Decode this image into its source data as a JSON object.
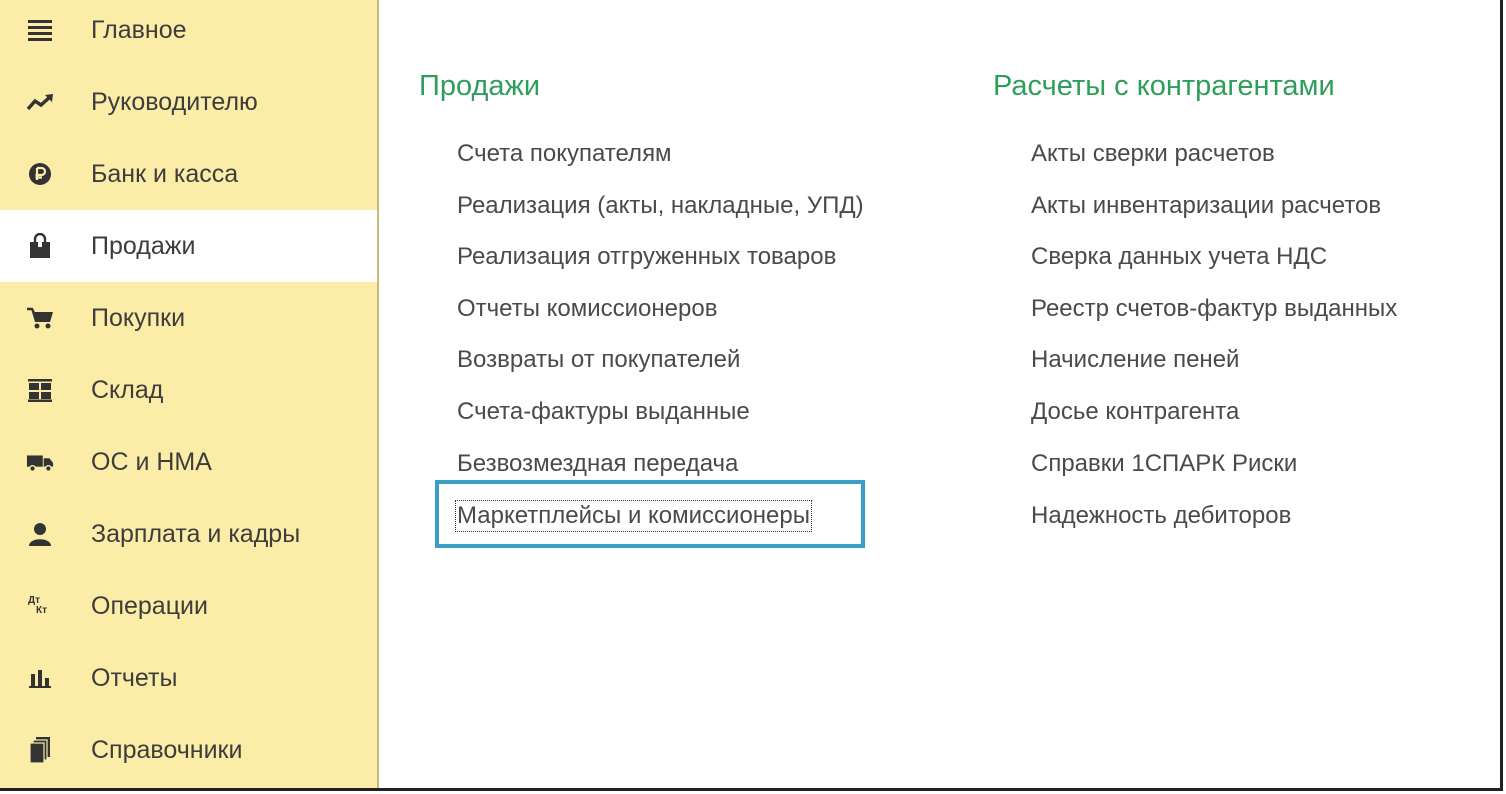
{
  "sidebar": {
    "items": [
      {
        "label": "Главное",
        "icon": "menu-icon"
      },
      {
        "label": "Руководителю",
        "icon": "trend-up-icon"
      },
      {
        "label": "Банк и касса",
        "icon": "ruble-icon"
      },
      {
        "label": "Продажи",
        "icon": "shopping-bag-icon",
        "active": true
      },
      {
        "label": "Покупки",
        "icon": "cart-icon"
      },
      {
        "label": "Склад",
        "icon": "warehouse-icon"
      },
      {
        "label": "ОС и НМА",
        "icon": "truck-icon"
      },
      {
        "label": "Зарплата и кадры",
        "icon": "person-icon"
      },
      {
        "label": "Операции",
        "icon": "dt-kt-icon"
      },
      {
        "label": "Отчеты",
        "icon": "bar-chart-icon"
      },
      {
        "label": "Справочники",
        "icon": "books-icon"
      }
    ]
  },
  "sales": {
    "title": "Продажи",
    "links": [
      "Счета покупателям",
      "Реализация (акты, накладные, УПД)",
      "Реализация отгруженных товаров",
      "Отчеты комиссионеров",
      "Возвраты от покупателей",
      "Счета-фактуры выданные",
      "Безвозмездная передача",
      "Маркетплейсы и комиссионеры"
    ]
  },
  "settlements": {
    "title": "Расчеты с контрагентами",
    "links": [
      "Акты сверки расчетов",
      "Акты инвентаризации расчетов",
      "Сверка данных учета НДС",
      "Реестр счетов-фактур выданных",
      "Начисление пеней",
      "Досье контрагента",
      "Справки 1СПАРК Риски",
      "Надежность дебиторов"
    ]
  },
  "icon_labels": {
    "dt": "Дт",
    "kt": "Кт"
  },
  "colors": {
    "sidebar_bg": "#fbeda8",
    "section_title": "#2f9e5a",
    "highlight": "#3b9fc5"
  }
}
